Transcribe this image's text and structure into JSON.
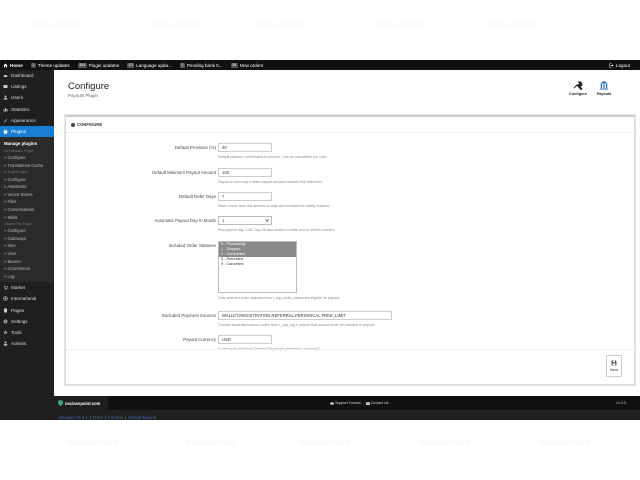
{
  "topbar": {
    "home": "Home",
    "notices": [
      {
        "count": "1",
        "label": "Theme updates"
      },
      {
        "count": "104",
        "label": "Plugin updates"
      },
      {
        "count": "13",
        "label": "Language upda..."
      },
      {
        "count": "2",
        "label": "Pending bank tr..."
      },
      {
        "count": "36",
        "label": "New orders"
      }
    ],
    "logout": "Logout"
  },
  "sidebar": {
    "items_top": [
      {
        "label": "Dashboard",
        "icon": "dashboard-icon"
      },
      {
        "label": "Listings",
        "icon": "listings-icon"
      },
      {
        "label": "Users",
        "icon": "users-icon"
      },
      {
        "label": "Statistics",
        "icon": "statistics-icon"
      },
      {
        "label": "Appearance",
        "icon": "appearance-icon"
      },
      {
        "label": "Plugins",
        "icon": "plugins-icon"
      }
    ],
    "submenu": {
      "head": "Manage plugins",
      "groups": [
        {
          "title": "Oc Translator Plugin",
          "links": [
            "Configure",
            "Translations Cache"
          ]
        },
        {
          "title": "Ai Support Agent",
          "links": [
            "Configure",
            "Assistants",
            "Vector Stores",
            "Files",
            "Conversations",
            "Skills"
          ]
        },
        {
          "title": "Osclass Pay Plugin",
          "links": [
            "Configure",
            "Gateways",
            "Item",
            "User",
            "Banner",
            "eCommerce",
            "Log"
          ]
        }
      ]
    },
    "items_bottom": [
      {
        "label": "Market",
        "icon": "market-icon"
      },
      {
        "label": "International",
        "icon": "globe-icon"
      },
      {
        "label": "Pages",
        "icon": "pages-icon"
      },
      {
        "label": "Settings",
        "icon": "settings-icon"
      },
      {
        "label": "Tools",
        "icon": "tools-icon"
      },
      {
        "label": "Admins",
        "icon": "admins-icon"
      }
    ]
  },
  "page": {
    "title": "Configure",
    "subtitle": "Payouts Plugin",
    "actions": [
      {
        "label": "Configure",
        "icon": "configure-icon"
      },
      {
        "label": "Payouts",
        "icon": "bank-icon"
      }
    ]
  },
  "card": {
    "title": "CONFIGURE",
    "fields": {
      "provision": {
        "label": "Default Provision (%)",
        "value": "20",
        "help": "Default platform commission in percent. Can be overwritten per user."
      },
      "min_payout": {
        "label": "Default Minimum Payout Amount",
        "value": "100",
        "help": "Payout is sent only if seller payout amount reaches this threshold."
      },
      "defer_days": {
        "label": "Default Defer Days",
        "value": "7",
        "help": "Sales newer than this amount of days are excluded for safety reasons."
      },
      "payout_day": {
        "label": "Automatic Payout Day In Month",
        "value": "1",
        "help": "Pick payout day. 1-28. Day 28 also works in month end in shorter months."
      },
      "statuses": {
        "label": "Included Order Statuses",
        "options": [
          {
            "text": "0 - Processing",
            "selected": true
          },
          {
            "text": "1 - Shipped",
            "selected": true
          },
          {
            "text": "2 - Completed",
            "selected": true
          },
          {
            "text": "5 - Refunded",
            "selected": false
          },
          {
            "text": "9 - Cancelled",
            "selected": false
          }
        ],
        "help": "Only selected order statuses from t_osp_order_status are eligible for payout."
      },
      "excluded": {
        "label": "Excluded Payment Sources",
        "value": "WALLET,REGISTRATION,REFERRAL,PERIODICAL,FREE_LIMIT",
        "help": "Comma separated source codes from t_osp_log.s_source that should never be included in payout."
      },
      "currency": {
        "label": "Payout Currency",
        "value": "USD",
        "help": "Currency is read from Osclass Pay plugin preference \"currency\"."
      }
    },
    "save_label": "Save"
  },
  "footer": {
    "brand": "osclasspoint.com",
    "support": "Support Forums",
    "contact": "Contact Us",
    "version": "v1.0.0"
  },
  "bottom": {
    "links": [
      "Osclass v8.3.1",
      "Docs",
      "Forums",
      "Official Market"
    ],
    "user": "Administrator"
  },
  "watermark": "OsclassPoint"
}
